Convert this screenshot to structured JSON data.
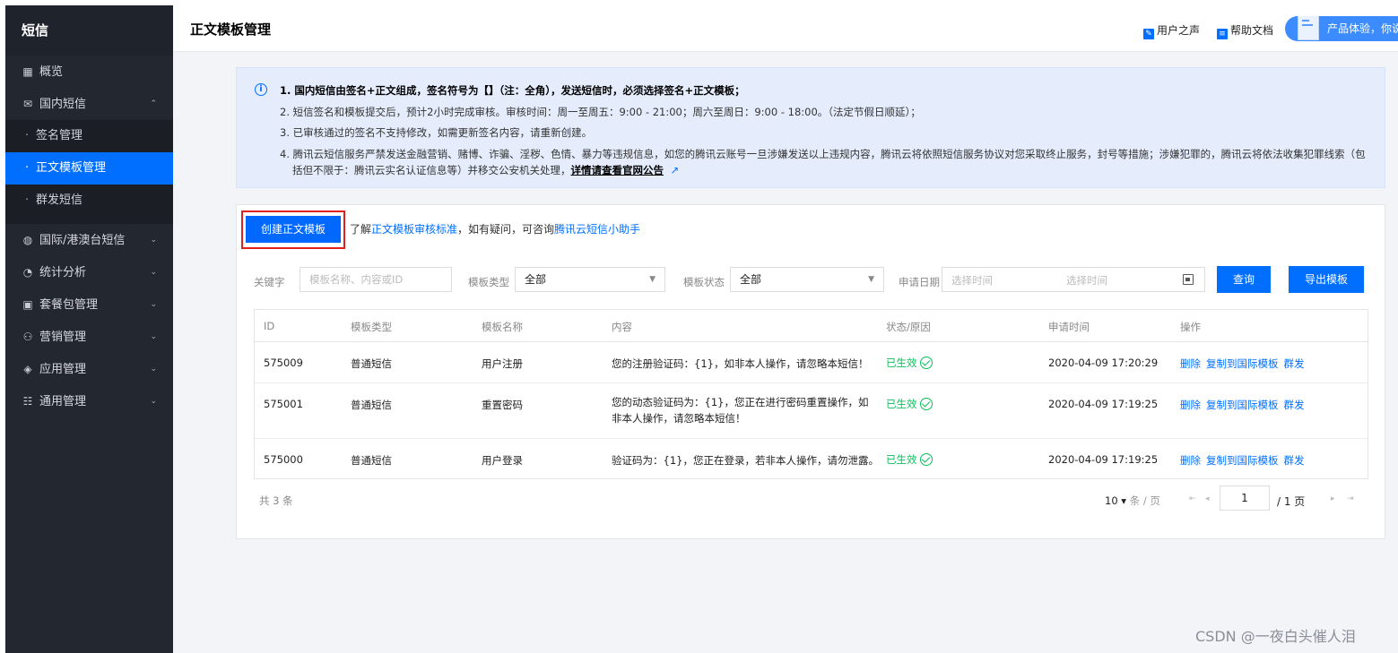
{
  "sidebar": {
    "title": "短信",
    "items": [
      {
        "icon": "grid-icon",
        "icon_char": "▦",
        "label": "概览",
        "chev": ""
      },
      {
        "icon": "message-icon",
        "icon_char": "✉",
        "label": "国内短信",
        "chev": "⌃"
      },
      {
        "label": "签名管理",
        "dot": "·"
      },
      {
        "label": "正文模板管理",
        "dot": "·"
      },
      {
        "label": "群发短信",
        "dot": "·"
      },
      {
        "icon": "globe-icon",
        "icon_char": "◍",
        "label": "国际/港澳台短信",
        "chev": "⌄"
      },
      {
        "icon": "pie-chart-icon",
        "icon_char": "◔",
        "label": "统计分析",
        "chev": "⌄"
      },
      {
        "icon": "package-icon",
        "icon_char": "▣",
        "label": "套餐包管理",
        "chev": "⌄"
      },
      {
        "icon": "users-icon",
        "icon_char": "⚇",
        "label": "营销管理",
        "chev": "⌄"
      },
      {
        "icon": "app-icon",
        "icon_char": "◈",
        "label": "应用管理",
        "chev": "⌄"
      },
      {
        "icon": "settings-list-icon",
        "icon_char": "☷",
        "label": "通用管理",
        "chev": "⌄"
      }
    ]
  },
  "header": {
    "title": "正文模板管理",
    "links": [
      {
        "icon": "edit-icon",
        "icon_char": "✎",
        "label": "用户之声"
      },
      {
        "icon": "doc-icon",
        "icon_char": "≡",
        "label": "帮助文档"
      }
    ],
    "promo": "产品体验，你说"
  },
  "notice": {
    "info_char": "i",
    "line1": "1. 国内短信由签名+正文组成，签名符号为【】（注：全角），发送短信时，必须选择签名+正文模板；",
    "line2": "2. 短信签名和模板提交后，预计2小时完成审核。审核时间：周一至周五：9:00 - 21:00；周六至周日：9:00 - 18:00。（法定节假日顺延）；",
    "line3": "3. 已审核通过的签名不支持修改，如需更新签名内容，请重新创建。",
    "line4a": "4. 腾讯云短信服务严禁发送金融营销、赌博、诈骗、淫秽、色情、暴力等违规信息，如您的腾讯云账号一旦涉嫌发送以上违规内容，腾讯云将依照短信服务协议对您采取终止服务，封号等措施；涉嫌犯罪的，腾讯云将依法收集犯罪线索（包",
    "line4b": "括但不限于：腾讯云实名认证信息等）并移交公安机关处理，",
    "line4_link": "详情请查看官网公告",
    "ext_icon_char": "↗"
  },
  "toolbar": {
    "create_label": "创建正文模板",
    "hint_pre": "了解",
    "hint_link1": "正文模板审核标准",
    "hint_mid": "，如有疑问，可咨询",
    "hint_link2": "腾讯云短信小助手"
  },
  "filters": {
    "keyword_label": "关键字",
    "keyword_placeholder": "模板名称、内容或ID",
    "type_label": "模板类型",
    "type_value": "全部",
    "status_label": "模板状态",
    "status_value": "全部",
    "date_label": "申请日期",
    "date_start_placeholder": "选择时间",
    "date_end_placeholder": "选择时间",
    "arrow_char": "▼",
    "query_label": "查询",
    "export_label": "导出模板"
  },
  "table": {
    "headers": [
      "ID",
      "模板类型",
      "模板名称",
      "内容",
      "状态/原因",
      "申请时间",
      "操作"
    ],
    "rows": [
      {
        "id": "575009",
        "type": "普通短信",
        "name": "用户注册",
        "content": "您的注册验证码：{1}，如非本人操作，请忽略本短信！",
        "status": "已生效",
        "time": "2020-04-09 17:20:29",
        "actions": [
          "删除",
          "复制到国际模板",
          "群发"
        ]
      },
      {
        "id": "575001",
        "type": "普通短信",
        "name": "重置密码",
        "content": "您的动态验证码为：{1}，您正在进行密码重置操作，如非本人操作，请忽略本短信！",
        "status": "已生效",
        "time": "2020-04-09 17:19:25",
        "actions": [
          "删除",
          "复制到国际模板",
          "群发"
        ]
      },
      {
        "id": "575000",
        "type": "普通短信",
        "name": "用户登录",
        "content": "验证码为：{1}，您正在登录，若非本人操作，请勿泄露。",
        "status": "已生效",
        "time": "2020-04-09 17:19:25",
        "actions": [
          "删除",
          "复制到国际模板",
          "群发"
        ]
      }
    ]
  },
  "pagination": {
    "total": "共 3 条",
    "page_size": "10",
    "size_arrow": "▾",
    "size_unit": "条 / 页",
    "first": "⇤",
    "prev": "◂",
    "current": "1",
    "of_total": "/ 1 页",
    "next": "▸",
    "last": "⇥"
  },
  "watermark": "CSDN @一夜白头催人泪",
  "colors": {
    "accent": "#006eff",
    "sidebar_bg": "#232730",
    "success": "#0abf5b",
    "highlight_border": "#e02020"
  }
}
